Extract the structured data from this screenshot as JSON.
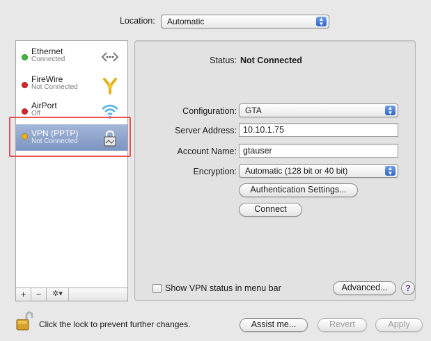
{
  "location": {
    "label": "Location:",
    "value": "Automatic"
  },
  "services": [
    {
      "name": "Ethernet",
      "status": "Connected",
      "status_color": "#3fb83c",
      "icon": "ethernet-arrows-icon"
    },
    {
      "name": "FireWire",
      "status": "Not Connected",
      "status_color": "#d9262b",
      "icon": "firewire-icon"
    },
    {
      "name": "AirPort",
      "status": "Off",
      "status_color": "#d9262b",
      "icon": "wifi-icon"
    },
    {
      "name": "VPN (PPTP)",
      "status": "Not Connected",
      "status_color": "#f0b21d",
      "icon": "vpn-lock-icon"
    }
  ],
  "sidebar_toolbar": {
    "add": "+",
    "remove": "−",
    "actions": "✲▾"
  },
  "detail": {
    "status_label": "Status:",
    "status_value": "Not Connected",
    "configuration_label": "Configuration:",
    "configuration_value": "GTA",
    "server_label": "Server Address:",
    "server_value": "10.10.1.75",
    "account_label": "Account Name:",
    "account_value": "gtauser",
    "encryption_label": "Encryption:",
    "encryption_value": "Automatic (128 bit or 40 bit)",
    "auth_button": "Authentication Settings...",
    "connect_button": "Connect",
    "show_status_label": "Show VPN status in menu bar",
    "show_status_checked": false,
    "advanced_button": "Advanced...",
    "help": "?"
  },
  "footer": {
    "lock_text": "Click the lock to prevent further changes.",
    "assist_button": "Assist me...",
    "revert_button": "Revert",
    "apply_button": "Apply"
  }
}
